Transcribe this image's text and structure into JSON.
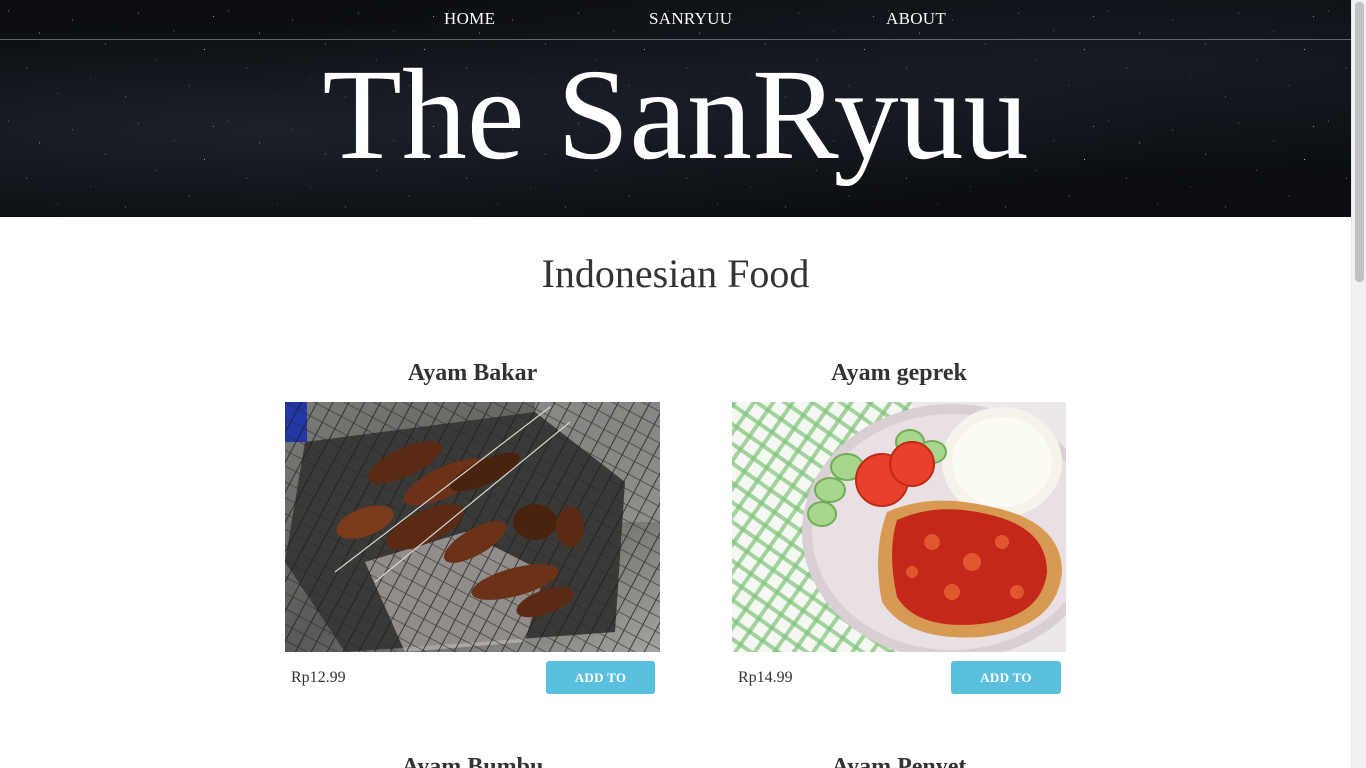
{
  "nav": {
    "items": [
      {
        "label": "HOME"
      },
      {
        "label": "SANRYUU"
      },
      {
        "label": "ABOUT"
      }
    ]
  },
  "hero": {
    "title": "The SanRyuu"
  },
  "section": {
    "title": "Indonesian Food"
  },
  "products": [
    {
      "name": "Ayam Bakar",
      "price": "Rp12.99",
      "button_label": "ADD TO CART",
      "image_icon": "grilled-chicken-skewers-photo"
    },
    {
      "name": "Ayam geprek",
      "price": "Rp14.99",
      "button_label": "ADD TO CART",
      "image_icon": "fried-chicken-sambal-rice-photo"
    }
  ],
  "next_products": [
    {
      "name": "Ayam Bumbu"
    },
    {
      "name": "Ayam Penyet"
    }
  ],
  "colors": {
    "accent": "#5bc0de",
    "hero_bg": "#0b0d10",
    "text": "#333333"
  }
}
